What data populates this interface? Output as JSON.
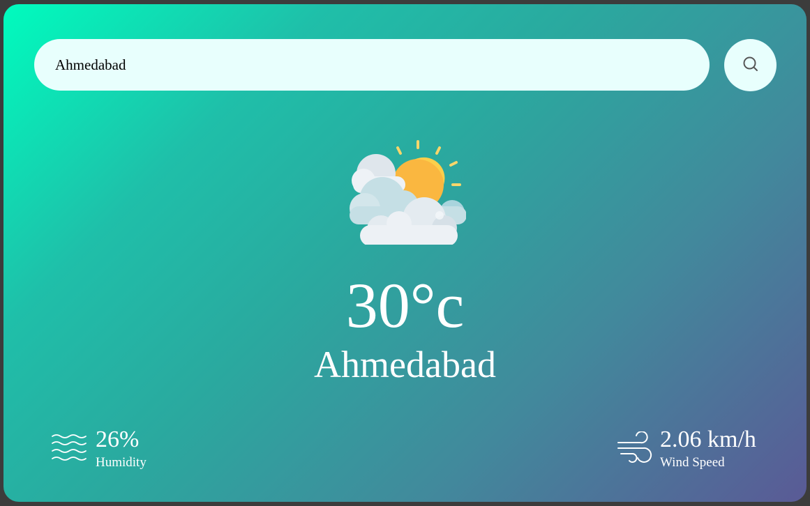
{
  "search": {
    "value": "Ahmedabad",
    "placeholder": "",
    "button_icon": "search-icon"
  },
  "weather": {
    "icon": "partly-cloudy-icon",
    "temperature": "30°c",
    "city": "Ahmedabad"
  },
  "humidity": {
    "icon": "humidity-waves-icon",
    "value": "26%",
    "label": "Humidity"
  },
  "wind": {
    "icon": "wind-icon",
    "value": "2.06 km/h",
    "label": "Wind Speed"
  },
  "colors": {
    "gradient_start": "#00fcbe",
    "gradient_end": "#5a5a96",
    "input_bg": "#e8fffd",
    "text": "#ffffff"
  }
}
